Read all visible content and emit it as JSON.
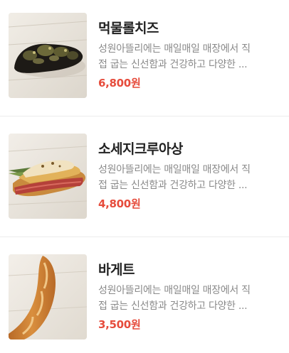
{
  "colors": {
    "name_text": "#222222",
    "description_text": "#8a8a8a",
    "price_text": "#e64c3c",
    "divider": "#ececec"
  },
  "products": [
    {
      "name": "먹물롤치즈",
      "description_line1": "성원아뜰리에는 매일매일 매장에서 직",
      "description_line2": "접 굽는 신선함과 건강하고 다양한 ...",
      "price": "6,800원",
      "image_icon": "squid-ink-cheese-roll-photo"
    },
    {
      "name": "소세지크루아상",
      "description_line1": "성원아뜰리에는 매일매일 매장에서 직",
      "description_line2": "접 굽는 신선함과 건강하고 다양한 ...",
      "price": "4,800원",
      "image_icon": "sausage-croissant-photo"
    },
    {
      "name": "바게트",
      "description_line1": "성원아뜰리에는 매일매일 매장에서 직",
      "description_line2": "접 굽는 신선함과 건강하고 다양한 ...",
      "price": "3,500원",
      "image_icon": "baguette-photo"
    }
  ]
}
